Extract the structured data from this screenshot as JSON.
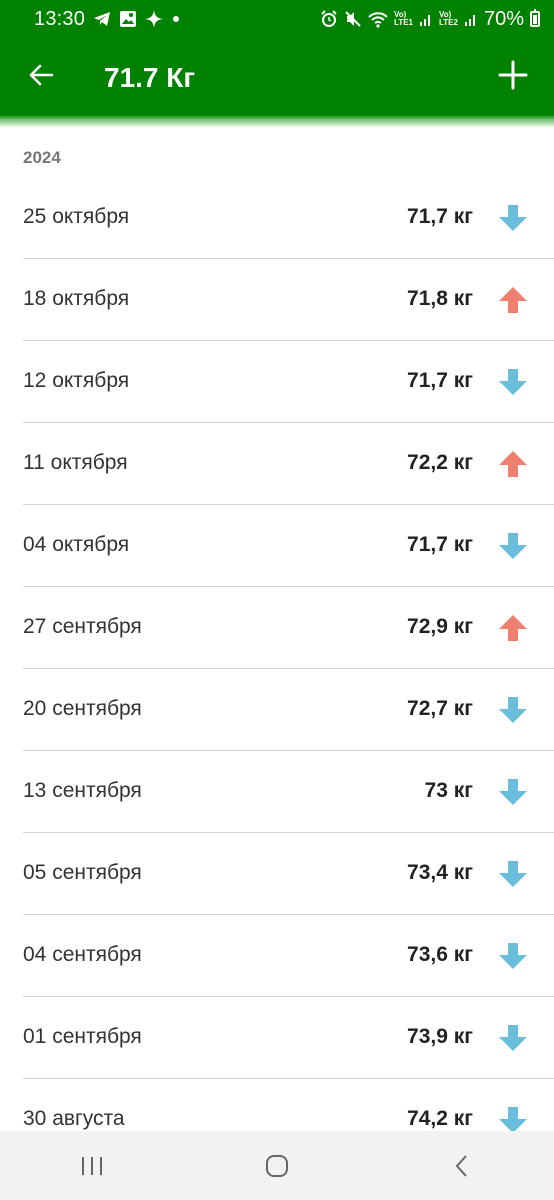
{
  "status_bar": {
    "time": "13:30",
    "battery": "70%",
    "sim1_label": [
      "Vo)",
      "LTE1"
    ],
    "sim2_label": [
      "Vo)",
      "LTE2"
    ],
    "icons_left": [
      "telegram-icon",
      "gallery-icon",
      "sparkle-icon",
      "dot-icon"
    ],
    "icons_right": [
      "alarm-icon",
      "mute-icon",
      "wifi-icon",
      "signal-icon",
      "battery-icon"
    ]
  },
  "app_bar": {
    "title": "71.7 Кг",
    "back_icon": "arrow-left-icon",
    "add_icon": "plus-icon",
    "color": "#008200"
  },
  "list": {
    "year": "2024",
    "entries": [
      {
        "date": "25 октября",
        "weight": "71,7 кг",
        "trend": "down"
      },
      {
        "date": "18 октября",
        "weight": "71,8 кг",
        "trend": "up"
      },
      {
        "date": "12 октября",
        "weight": "71,7 кг",
        "trend": "down"
      },
      {
        "date": "11 октября",
        "weight": "72,2 кг",
        "trend": "up"
      },
      {
        "date": "04 октября",
        "weight": "71,7 кг",
        "trend": "down"
      },
      {
        "date": "27 сентября",
        "weight": "72,9 кг",
        "trend": "up"
      },
      {
        "date": "20 сентября",
        "weight": "72,7 кг",
        "trend": "down"
      },
      {
        "date": "13 сентября",
        "weight": "73 кг",
        "trend": "down"
      },
      {
        "date": "05 сентября",
        "weight": "73,4 кг",
        "trend": "down"
      },
      {
        "date": "04 сентября",
        "weight": "73,6 кг",
        "trend": "down"
      },
      {
        "date": "01 сентября",
        "weight": "73,9 кг",
        "trend": "down"
      },
      {
        "date": "30 августа",
        "weight": "74,2 кг",
        "trend": "down"
      }
    ],
    "colors": {
      "down": "#6bbddc",
      "up": "#ee8070"
    }
  },
  "nav_bar": {
    "buttons": [
      "recent-apps-icon",
      "home-icon",
      "back-icon"
    ]
  }
}
